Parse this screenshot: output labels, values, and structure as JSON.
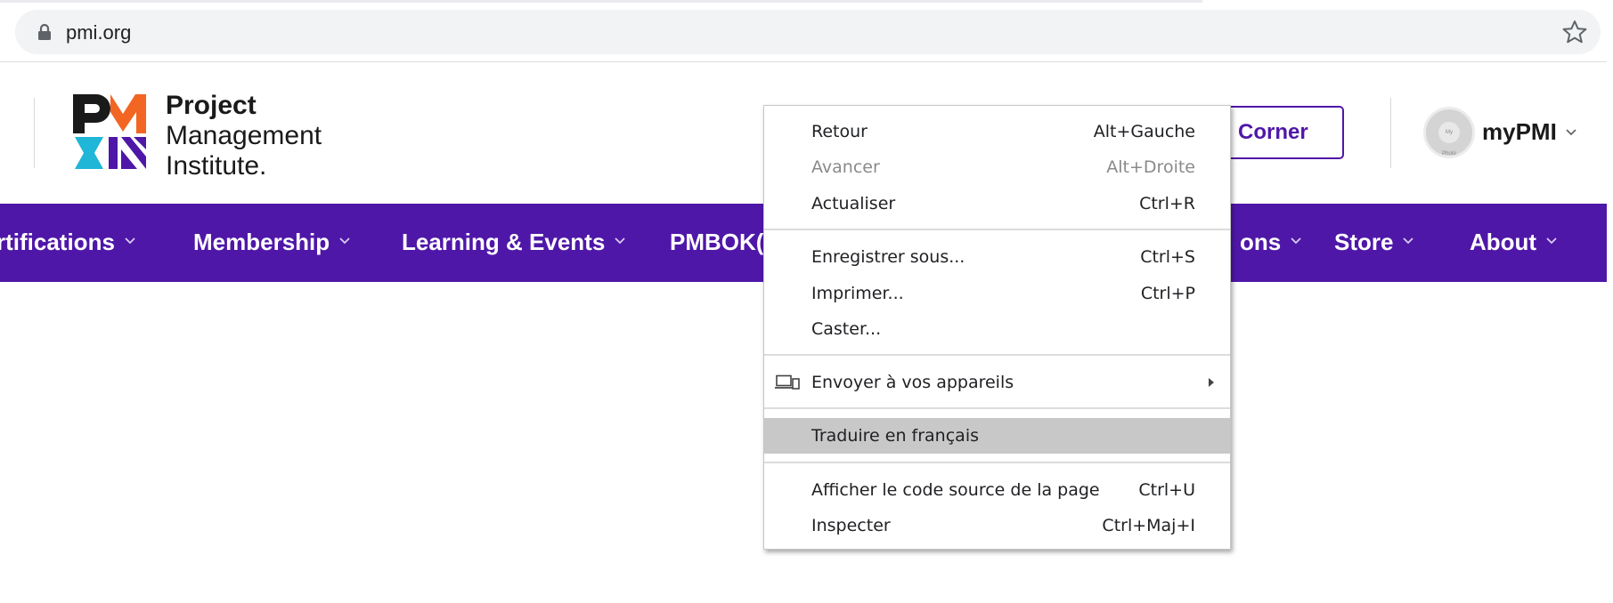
{
  "browser": {
    "url": "pmi.org",
    "lock_icon": "lock-icon",
    "bookmark_icon": "star-icon"
  },
  "header": {
    "logo_lines": [
      "Project",
      "Management",
      "Institute."
    ],
    "corner_button_label": "Corner",
    "account_label": "myPMI",
    "avatar_text": "My Photo"
  },
  "nav": {
    "items": [
      {
        "label": "rtifications"
      },
      {
        "label": "Membership"
      },
      {
        "label": "Learning & Events"
      },
      {
        "label": "PMBOK("
      },
      {
        "label": "ons"
      },
      {
        "label": "Store"
      },
      {
        "label": "About"
      }
    ]
  },
  "context_menu": {
    "items": [
      {
        "label": "Retour",
        "shortcut": "Alt+Gauche",
        "enabled": true
      },
      {
        "label": "Avancer",
        "shortcut": "Alt+Droite",
        "enabled": false
      },
      {
        "label": "Actualiser",
        "shortcut": "Ctrl+R",
        "enabled": true
      },
      {
        "label": "Enregistrer sous...",
        "shortcut": "Ctrl+S",
        "enabled": true
      },
      {
        "label": "Imprimer...",
        "shortcut": "Ctrl+P",
        "enabled": true
      },
      {
        "label": "Caster...",
        "shortcut": "",
        "enabled": true
      },
      {
        "label": "Envoyer à vos appareils",
        "shortcut": "",
        "enabled": true,
        "icon": "devices-icon",
        "submenu": true
      },
      {
        "label": "Traduire en français",
        "shortcut": "",
        "enabled": true,
        "highlighted": true
      },
      {
        "label": "Afficher le code source de la page",
        "shortcut": "Ctrl+U",
        "enabled": true
      },
      {
        "label": "Inspecter",
        "shortcut": "Ctrl+Maj+I",
        "enabled": true
      }
    ]
  },
  "colors": {
    "brand_purple": "#4f17a8",
    "logo_cyan": "#1fb6d8",
    "logo_orange": "#f26522",
    "menu_highlight": "#c8c8c8"
  }
}
